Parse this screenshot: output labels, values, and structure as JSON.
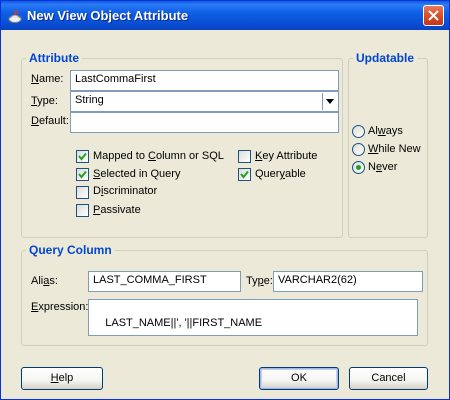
{
  "window": {
    "title": "New View Object Attribute",
    "colors": {
      "titlebar": "#0A52D8",
      "background": "#ECE9D8",
      "group_title": "#0046D5",
      "check": "#21A121"
    }
  },
  "attribute": {
    "group_title": "Attribute",
    "name": {
      "label_mnemonic": "N",
      "label_rest": "ame:",
      "value": "LastCommaFirst"
    },
    "type": {
      "label_mnemonic": "T",
      "label_rest": "ype:",
      "value": "String"
    },
    "default": {
      "label_mnemonic": "D",
      "label_rest": "efault:",
      "value": ""
    },
    "checkboxes": [
      {
        "pre": "Mapped to ",
        "mnemonic": "C",
        "post": "olumn or SQL",
        "checked": true
      },
      {
        "pre": "",
        "mnemonic": "S",
        "post": "elected in Query",
        "checked": true
      },
      {
        "pre": "D",
        "mnemonic": "i",
        "post": "scriminator",
        "checked": false
      },
      {
        "pre": "",
        "mnemonic": "P",
        "post": "assivate",
        "checked": false
      },
      {
        "pre": "",
        "mnemonic": "K",
        "post": "ey Attribute",
        "checked": false
      },
      {
        "pre": "Quer",
        "mnemonic": "y",
        "post": "able",
        "checked": true
      }
    ]
  },
  "updatable": {
    "group_title": "Updatable",
    "options": [
      {
        "pre": "Al",
        "mnemonic": "w",
        "post": "ays",
        "selected": false
      },
      {
        "pre": "",
        "mnemonic": "W",
        "post": "hile New",
        "selected": false
      },
      {
        "pre": "N",
        "mnemonic": "e",
        "post": "ver",
        "selected": true
      }
    ]
  },
  "query_column": {
    "group_title": "Query Column",
    "alias": {
      "label_pre": "Ali",
      "label_mnemonic": "a",
      "label_post": "s:",
      "value": "LAST_COMMA_FIRST"
    },
    "type": {
      "label_pre": "Ty",
      "label_mnemonic": "p",
      "label_post": "e:",
      "value": "VARCHAR2(62)"
    },
    "expression": {
      "label_pre": "",
      "label_mnemonic": "E",
      "label_post": "xpression:",
      "value": "LAST_NAME||', '||FIRST_NAME"
    }
  },
  "buttons": {
    "help": {
      "mnemonic": "H",
      "rest": "elp"
    },
    "ok": {
      "label": "OK"
    },
    "cancel": {
      "label": "Cancel"
    }
  }
}
